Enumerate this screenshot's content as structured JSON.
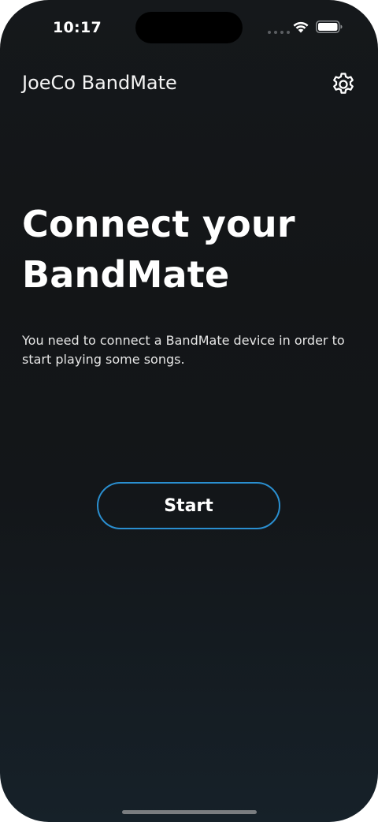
{
  "status_bar": {
    "time": "10:17"
  },
  "header": {
    "app_title": "JoeCo BandMate",
    "settings_icon": "gear-icon"
  },
  "main": {
    "headline": "Connect your BandMate",
    "description": "You need to connect a BandMate device in order to start playing some songs.",
    "start_label": "Start"
  },
  "colors": {
    "background": "#131517",
    "accent": "#2a8fd0",
    "text": "#ffffff"
  }
}
